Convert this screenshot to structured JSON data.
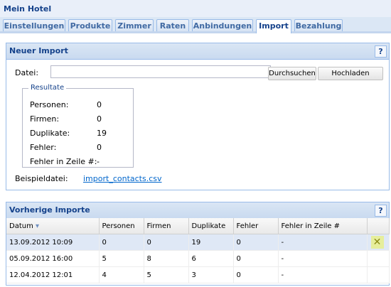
{
  "app": {
    "title": "Mein Hotel"
  },
  "tabs": [
    "Einstellungen",
    "Produkte",
    "Zimmer",
    "Raten",
    "Anbindungen",
    "Import",
    "Bezahlung"
  ],
  "active_tab": "Import",
  "import_panel": {
    "title": "Neuer Import",
    "help": "?",
    "file_label": "Datei:",
    "file_value": "",
    "browse_label": "Durchsuchen",
    "upload_label": "Hochladen",
    "results": {
      "legend": "Resultate",
      "rows": [
        {
          "label": "Personen:",
          "value": "0"
        },
        {
          "label": "Firmen:",
          "value": "0"
        },
        {
          "label": "Duplikate:",
          "value": "19"
        },
        {
          "label": "Fehler:",
          "value": "0"
        },
        {
          "label": "Fehler in Zeile #:",
          "value": "-"
        }
      ]
    },
    "example_label": "Beispieldatei:",
    "example_link": "import_contacts.csv"
  },
  "history_panel": {
    "title": "Vorherige Importe",
    "help": "?",
    "sort_arrow": "▾",
    "columns": [
      "Datum",
      "Personen",
      "Firmen",
      "Duplikate",
      "Fehler",
      "Fehler in Zeile #"
    ],
    "rows": [
      [
        "13.09.2012 10:09",
        "0",
        "0",
        "19",
        "0",
        "-"
      ],
      [
        "05.09.2012 16:00",
        "5",
        "8",
        "6",
        "0",
        "-"
      ],
      [
        "12.04.2012 12:01",
        "4",
        "5",
        "3",
        "0",
        "-"
      ]
    ],
    "delete_icon": "✕"
  }
}
